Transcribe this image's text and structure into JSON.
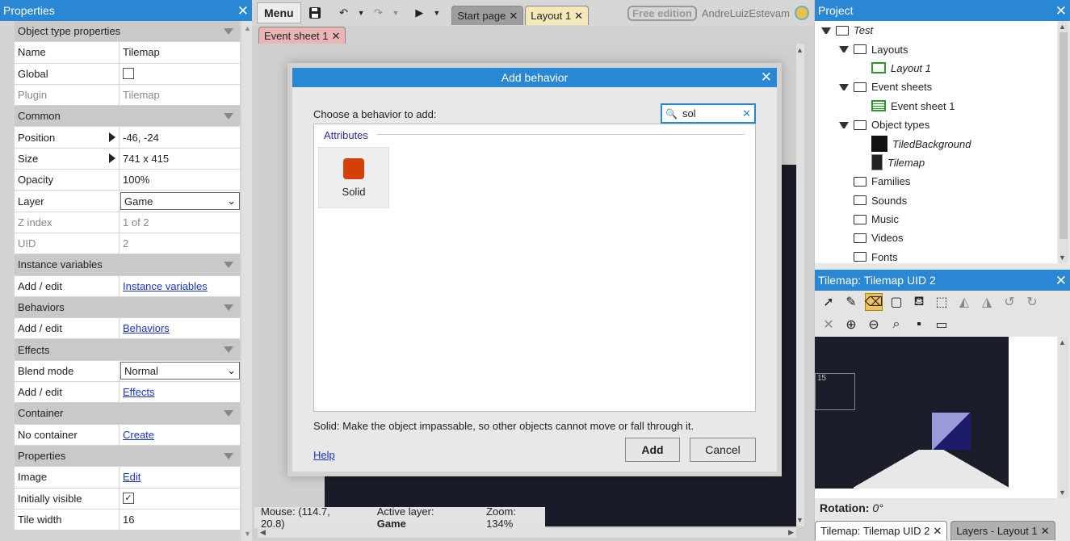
{
  "left_panel": {
    "title": "Properties",
    "sections": [
      {
        "cat": "Object type properties",
        "rows": [
          {
            "k": "Name",
            "v": "Tilemap"
          },
          {
            "k": "Global",
            "v": ""
          },
          {
            "k": "Plugin",
            "v": "Tilemap"
          }
        ]
      },
      {
        "cat": "Common",
        "rows": [
          {
            "k": "Position",
            "v": "-46, -24"
          },
          {
            "k": "Size",
            "v": "741 x 415"
          },
          {
            "k": "Opacity",
            "v": "100%"
          },
          {
            "k": "Layer",
            "v": "Game"
          },
          {
            "k": "Z index",
            "v": "1 of 2"
          },
          {
            "k": "UID",
            "v": "2"
          }
        ]
      },
      {
        "cat": "Instance variables",
        "rows": [
          {
            "k": "Add / edit",
            "v": "Instance variables"
          }
        ]
      },
      {
        "cat": "Behaviors",
        "rows": [
          {
            "k": "Add / edit",
            "v": "Behaviors"
          }
        ]
      },
      {
        "cat": "Effects",
        "rows": [
          {
            "k": "Blend mode",
            "v": "Normal"
          },
          {
            "k": "Add / edit",
            "v": "Effects"
          }
        ]
      },
      {
        "cat": "Container",
        "rows": [
          {
            "k": "No container",
            "v": "Create"
          }
        ]
      },
      {
        "cat": "Properties",
        "rows": [
          {
            "k": "Image",
            "v": "Edit"
          },
          {
            "k": "Initially visible",
            "v": ""
          },
          {
            "k": "Tile width",
            "v": "16"
          }
        ]
      }
    ]
  },
  "toolbar": {
    "menu": "Menu",
    "tabs": [
      "Start page",
      "Layout 1"
    ],
    "subtab": "Event sheet 1",
    "edition": "Free edition",
    "user": "AndreLuizEstevam"
  },
  "footer": {
    "mouse": "Mouse: (114.7, 20.8)",
    "layer_label": "Active layer:",
    "layer": "Game",
    "zoom": "Zoom: 134%"
  },
  "project": {
    "title": "Project",
    "items": [
      {
        "label": "Test",
        "lvl": 0,
        "type": "folder",
        "open": true,
        "italic": true
      },
      {
        "label": "Layouts",
        "lvl": 1,
        "type": "folder",
        "open": true
      },
      {
        "label": "Layout 1",
        "lvl": 2,
        "type": "layout",
        "italic": true
      },
      {
        "label": "Event sheets",
        "lvl": 1,
        "type": "folder",
        "open": true
      },
      {
        "label": "Event sheet 1",
        "lvl": 2,
        "type": "sheet"
      },
      {
        "label": "Object types",
        "lvl": 1,
        "type": "folder",
        "open": true
      },
      {
        "label": "TiledBackground",
        "lvl": 2,
        "type": "obj",
        "italic": true
      },
      {
        "label": "Tilemap",
        "lvl": 2,
        "type": "tmap",
        "italic": true
      },
      {
        "label": "Families",
        "lvl": 1,
        "type": "folder"
      },
      {
        "label": "Sounds",
        "lvl": 1,
        "type": "folder"
      },
      {
        "label": "Music",
        "lvl": 1,
        "type": "folder"
      },
      {
        "label": "Videos",
        "lvl": 1,
        "type": "folder"
      },
      {
        "label": "Fonts",
        "lvl": 1,
        "type": "folder"
      }
    ]
  },
  "tilemap": {
    "title": "Tilemap: Tilemap UID 2",
    "tile_label": "15",
    "rotation_label": "Rotation:",
    "rotation": "0°",
    "bottom_tabs": [
      "Tilemap: Tilemap UID 2",
      "Layers - Layout 1"
    ]
  },
  "modal": {
    "title": "Add behavior",
    "prompt": "Choose a behavior to add:",
    "search": "sol",
    "group": "Attributes",
    "item": "Solid",
    "item_color": "#d4400a",
    "description": "Solid: Make the object impassable, so other objects cannot move or fall through it.",
    "help": "Help",
    "add": "Add",
    "cancel": "Cancel"
  }
}
